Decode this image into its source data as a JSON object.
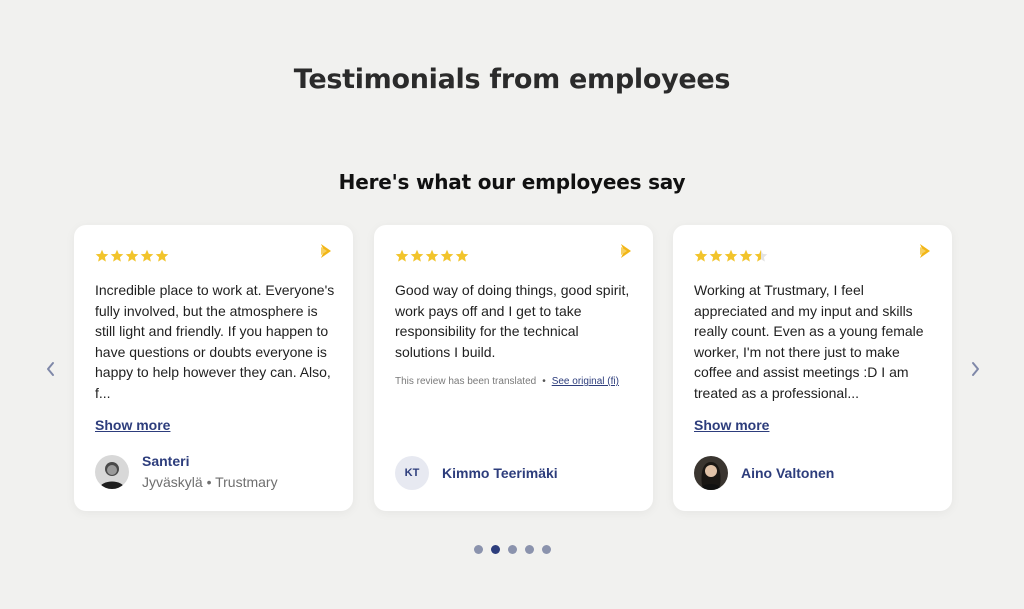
{
  "page": {
    "title": "Testimonials from employees",
    "section_title": "Here's what our employees say"
  },
  "colors": {
    "background": "#f1f1ef",
    "star": "#f2c42b",
    "brand": "#f2b616",
    "accent": "#2d3d7c"
  },
  "carousel": {
    "prev_icon": "chevron-left-icon",
    "next_icon": "chevron-right-icon",
    "dots": 5,
    "active_dot": 2
  },
  "testimonials": [
    {
      "rating": 5,
      "text": "Incredible place to work at. Everyone's fully involved, but the atmosphere is still light and friendly. If you happen to have questions or doubts everyone is happy to help however they can. Also, f...",
      "show_more": "Show more",
      "author": {
        "name": "Santeri",
        "meta": "Jyväskylä • Trustmary",
        "avatar": "photo"
      }
    },
    {
      "rating": 5,
      "text": "Good way of doing things, good spirit, work pays off and I get to take responsibility for the technical solutions I build.",
      "translated_note": "This review has been translated",
      "separator": "•",
      "see_original": "See original (fi)",
      "author": {
        "name": "Kimmo Teerimäki",
        "initials": "KT"
      }
    },
    {
      "rating": 4.5,
      "text": "Working at Trustmary, I feel appreciated and my input and skills really count. Even as a young female worker, I'm not there just to make coffee and assist meetings :D I am treated as a professional...",
      "show_more": "Show more",
      "author": {
        "name": "Aino Valtonen",
        "avatar": "photo"
      }
    }
  ]
}
